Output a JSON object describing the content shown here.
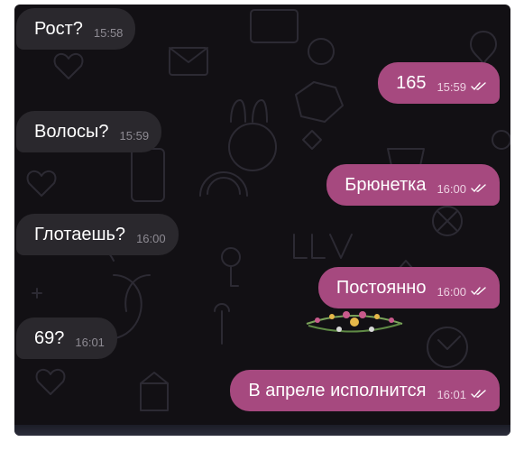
{
  "chat": {
    "messages": [
      {
        "direction": "incoming",
        "text": "Рост?",
        "time": "15:58"
      },
      {
        "direction": "outgoing",
        "text": "165",
        "time": "15:59",
        "status": "read"
      },
      {
        "direction": "incoming",
        "text": "Волосы?",
        "time": "15:59"
      },
      {
        "direction": "outgoing",
        "text": "Брюнетка",
        "time": "16:00",
        "status": "read"
      },
      {
        "direction": "incoming",
        "text": "Глотаешь?",
        "time": "16:00"
      },
      {
        "direction": "outgoing",
        "text": "Постоянно",
        "time": "16:00",
        "status": "read"
      },
      {
        "direction": "incoming",
        "text": "69?",
        "time": "16:01"
      },
      {
        "direction": "outgoing",
        "text": "В апреле исполнится",
        "time": "16:01",
        "status": "read"
      }
    ]
  },
  "theme": {
    "background": "#121014",
    "incoming_bubble": "#2a282d",
    "outgoing_bubble": "#a6497f",
    "text_color": "#ffffff"
  },
  "icons": {
    "read_status": "double-check-icon",
    "wallpaper": "love-doodles-pattern",
    "sticker": "floral-wreath-sticker"
  }
}
